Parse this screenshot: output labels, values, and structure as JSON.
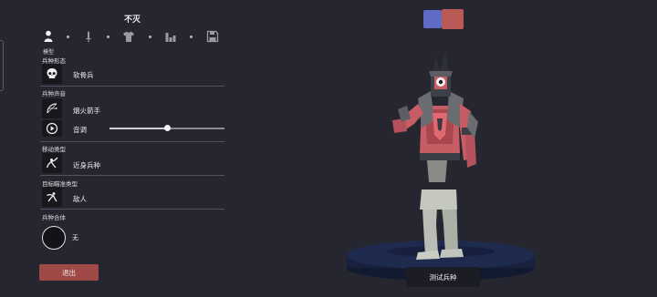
{
  "colors": {
    "background": "#262630",
    "exit": "#a04a48",
    "swatch_blue": "#5f6bc4",
    "swatch_red": "#b95a57"
  },
  "unit": {
    "name": "不灭"
  },
  "tabs": {
    "items": [
      {
        "icon": "person-icon",
        "caption": "模型"
      },
      {
        "icon": "sword-icon"
      },
      {
        "icon": "shirt-icon"
      },
      {
        "icon": "bar-chart-icon"
      },
      {
        "icon": "save-icon"
      }
    ]
  },
  "form": {
    "label": "兵种形态",
    "value": "软骨兵",
    "icon": "skull-icon"
  },
  "voice": {
    "label": "兵种声音",
    "value": "烟火箭手",
    "icon": "bow-icon",
    "volume_label": "音调",
    "play_icon": "play-icon",
    "volume": 0.5
  },
  "movement": {
    "label": "移动类型",
    "value": "近身兵种",
    "icon": "melee-icon"
  },
  "targeting": {
    "label": "目标瞄准类型",
    "value": "敌人",
    "icon": "target-icon"
  },
  "merge": {
    "label": "兵种合体",
    "value": "无"
  },
  "exit_label": "退出",
  "test_label": "测试兵种"
}
